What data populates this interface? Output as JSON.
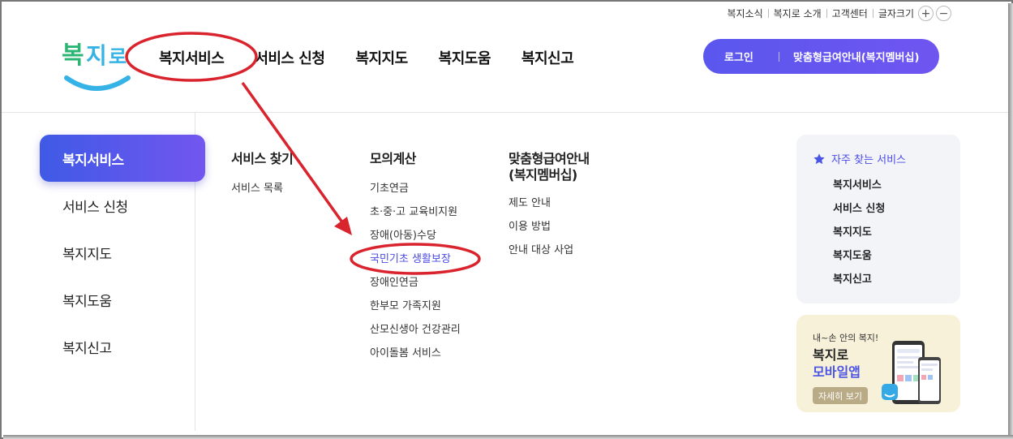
{
  "utility": {
    "items": [
      "복지소식",
      "복지로 소개",
      "고객센터"
    ],
    "font_size_label": "글자크기",
    "zoom_in": "+",
    "zoom_out": "−"
  },
  "logo": {
    "text": "복지로"
  },
  "gnb": [
    "복지서비스",
    "서비스 신청",
    "복지지도",
    "복지도움",
    "복지신고"
  ],
  "login": {
    "login_label": "로그인",
    "membership_label": "맞춤형급여안내(복지멤버십)"
  },
  "left_menu": [
    "복지서비스",
    "서비스 신청",
    "복지지도",
    "복지도움",
    "복지신고"
  ],
  "columns": [
    {
      "title": "서비스 찾기",
      "links": [
        "서비스 목록"
      ]
    },
    {
      "title": "모의계산",
      "links": [
        "기초연금",
        "초·중·고 교육비지원",
        "장애(아동)수당",
        "국민기초 생활보장",
        "장애인연금",
        "한부모 가족지원",
        "산모신생아 건강관리",
        "아이돌봄 서비스"
      ]
    },
    {
      "title": "맞춤형급여안내\n(복지멤버십)",
      "title_line1": "맞춤형급여안내",
      "title_line2": "(복지멤버십)",
      "links": [
        "제도 안내",
        "이용 방법",
        "안내 대상 사업"
      ]
    }
  ],
  "favorites": {
    "title": "자주 찾는 서비스",
    "links": [
      "복지서비스",
      "서비스 신청",
      "복지지도",
      "복지도움",
      "복지신고"
    ]
  },
  "app_banner": {
    "subtitle": "내~손 안의 복지!",
    "title1": "복지로",
    "title2": "모바일앱",
    "button": "자세히 보기"
  },
  "colors": {
    "accent": "#5a57ee",
    "annotation": "#d9232d",
    "highlight_link": "#4a4ae6"
  }
}
